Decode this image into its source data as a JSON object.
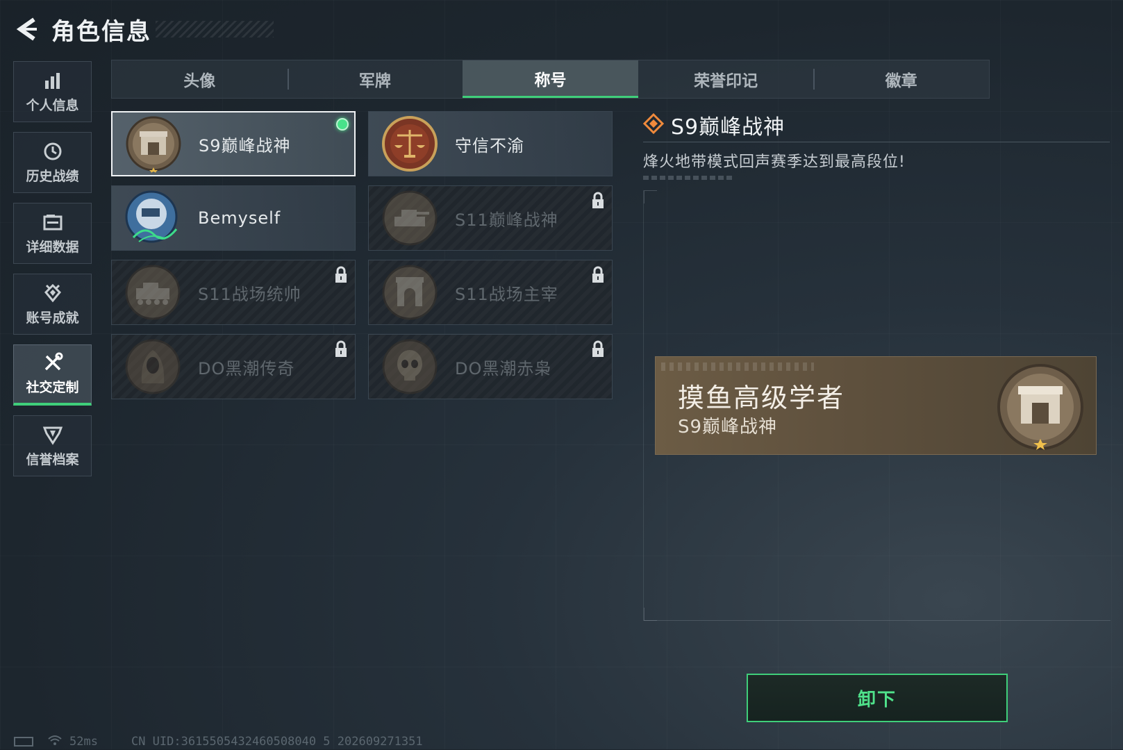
{
  "header": {
    "title": "角色信息",
    "back_icon": "chevron-left-icon"
  },
  "sidenav": {
    "items": [
      {
        "label": "个人信息",
        "icon": "bar-chart-icon",
        "active": false
      },
      {
        "label": "历史战绩",
        "icon": "history-clock-icon",
        "active": false
      },
      {
        "label": "详细数据",
        "icon": "folder-icon",
        "active": false
      },
      {
        "label": "账号成就",
        "icon": "achievement-icon",
        "active": false
      },
      {
        "label": "社交定制",
        "icon": "tools-icon",
        "active": true
      },
      {
        "label": "信誉档案",
        "icon": "credit-shield-icon",
        "active": false
      }
    ]
  },
  "tabs": [
    {
      "label": "头像",
      "active": false
    },
    {
      "label": "军牌",
      "active": false
    },
    {
      "label": "称号",
      "active": true
    },
    {
      "label": "荣誉印记",
      "active": false
    },
    {
      "label": "徽章",
      "active": false
    }
  ],
  "titles": [
    {
      "label": "S9巅峰战神",
      "emblem": "arch-laurel-emblem",
      "locked": false,
      "selected": true,
      "equipped": true
    },
    {
      "label": "守信不渝",
      "emblem": "scales-emblem",
      "locked": false,
      "selected": false,
      "equipped": false
    },
    {
      "label": "Bemyself",
      "emblem": "signature-emblem",
      "locked": false,
      "selected": false,
      "equipped": false
    },
    {
      "label": "S11巅峰战神",
      "emblem": "tank-laurel-emblem",
      "locked": true,
      "selected": false,
      "equipped": false
    },
    {
      "label": "S11战场统帅",
      "emblem": "apc-emblem",
      "locked": true,
      "selected": false,
      "equipped": false
    },
    {
      "label": "S11战场主宰",
      "emblem": "arch-emblem",
      "locked": true,
      "selected": false,
      "equipped": false
    },
    {
      "label": "DO黑潮传奇",
      "emblem": "hooded-figure-emblem",
      "locked": true,
      "selected": false,
      "equipped": false
    },
    {
      "label": "DO黑潮赤枭",
      "emblem": "skull-emblem",
      "locked": true,
      "selected": false,
      "equipped": false
    }
  ],
  "detail": {
    "title": "S9巅峰战神",
    "description": "烽火地带模式回声赛季达到最高段位!"
  },
  "nameplate": {
    "player_name": "摸鱼高级学者",
    "title": "S9巅峰战神"
  },
  "actions": {
    "unequip_label": "卸下"
  },
  "status": {
    "ping": "52ms",
    "uid": "CN UID:3615505432460508040 5 202609271351"
  },
  "colors": {
    "accent_green": "#3fcf7a",
    "equipped_dot": "#48e28a",
    "nameplate_bg": "#6c5c45"
  }
}
